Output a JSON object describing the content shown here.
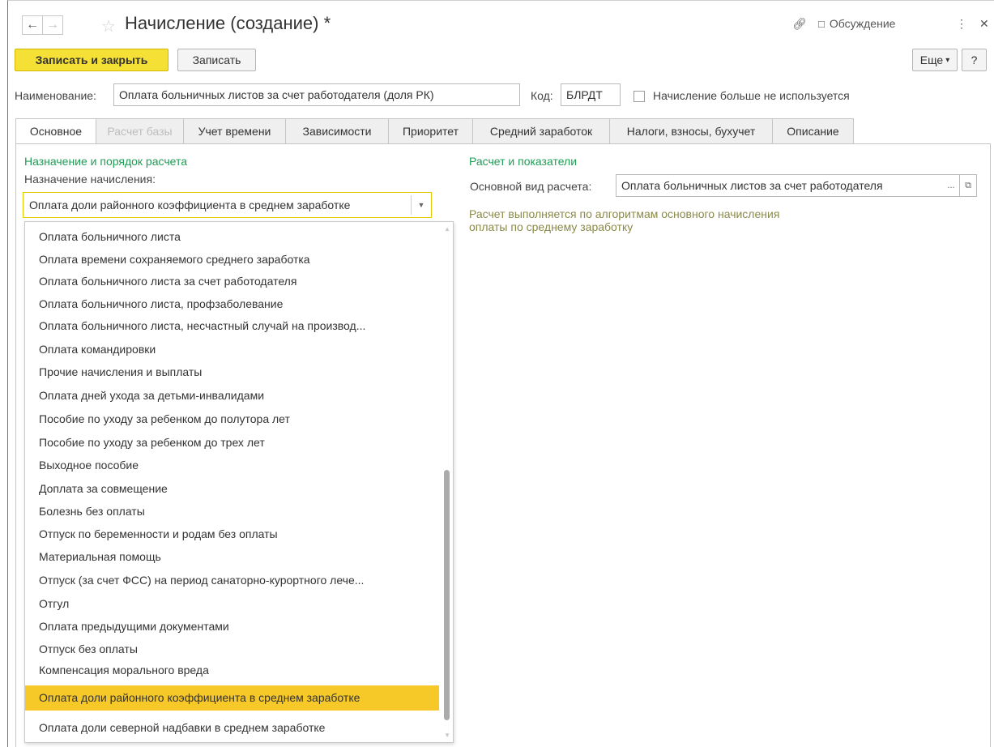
{
  "header": {
    "title": "Начисление (создание) *",
    "discussion_label": "Обсуждение"
  },
  "toolbar": {
    "save_close_label": "Записать и закрыть",
    "save_label": "Записать",
    "more_label": "Еще",
    "help_label": "?"
  },
  "form": {
    "name_label": "Наименование:",
    "name_value": "Оплата больничных листов за счет работодателя (доля РК)",
    "code_label": "Код:",
    "code_value": "БЛРДТ",
    "unused_label": "Начисление больше не используется"
  },
  "tabs": [
    {
      "label": "Основное"
    },
    {
      "label": "Расчет базы"
    },
    {
      "label": "Учет времени"
    },
    {
      "label": "Зависимости"
    },
    {
      "label": "Приоритет"
    },
    {
      "label": "Средний заработок"
    },
    {
      "label": "Налоги, взносы, бухучет"
    },
    {
      "label": "Описание"
    }
  ],
  "left": {
    "section_title": "Назначение и порядок расчета",
    "purpose_label": "Назначение начисления:",
    "purpose_value": "Оплата доли районного коэффициента в среднем заработке"
  },
  "dropdown": {
    "items": [
      "Оплата больничного листа",
      "Оплата времени сохраняемого среднего заработка",
      "Оплата больничного листа за счет работодателя",
      "Оплата больничного листа, профзаболевание",
      "Оплата больничного листа, несчастный случай на производ...",
      "Оплата командировки",
      "Прочие начисления и выплаты",
      "Оплата дней ухода за детьми-инвалидами",
      "Пособие по уходу за ребенком до полутора лет",
      "Пособие по уходу за ребенком до трех лет",
      "Выходное пособие",
      "Доплата за совмещение",
      "Болезнь без оплаты",
      "Отпуск по беременности и родам без оплаты",
      "Материальная помощь",
      "Отпуск (за счет ФСС) на период санаторно-курортного лече...",
      "Отгул",
      "Оплата предыдущими документами",
      "Отпуск без оплаты",
      "Компенсация морального вреда",
      "Оплата доли районного коэффициента в среднем заработке",
      "Оплата доли северной надбавки в среднем заработке"
    ],
    "selected_index": 20
  },
  "right": {
    "section_title": "Расчет и показатели",
    "base_kind_label": "Основной вид расчета:",
    "base_kind_value": "Оплата больничных листов за счет работодателя",
    "info_line1": "Расчет выполняется по алгоритмам основного начисления",
    "info_line2": "оплаты по среднему заработку"
  },
  "colors": {
    "accent_yellow": "#f5e036",
    "selection": "#f7c928",
    "section_green": "#1f9d55"
  }
}
